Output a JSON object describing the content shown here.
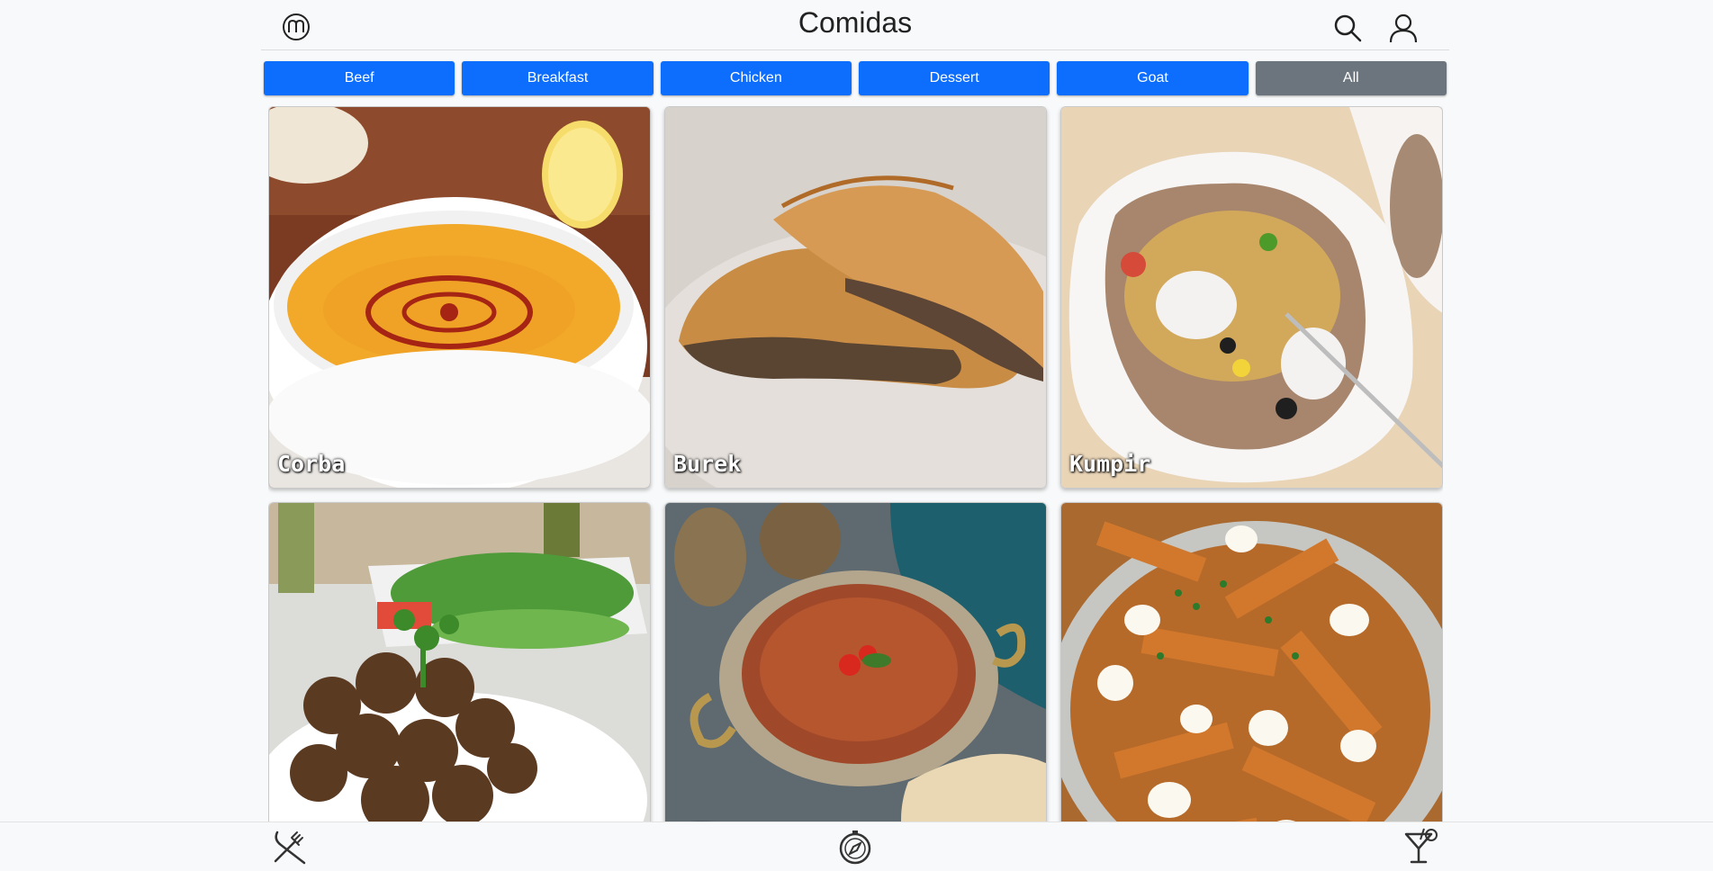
{
  "header": {
    "title": "Comidas",
    "logo_icon": "chef-hat-logo-icon",
    "search_icon": "search-icon",
    "profile_icon": "profile-icon"
  },
  "filters": [
    {
      "label": "Beef",
      "style": "primary"
    },
    {
      "label": "Breakfast",
      "style": "primary"
    },
    {
      "label": "Chicken",
      "style": "primary"
    },
    {
      "label": "Dessert",
      "style": "primary"
    },
    {
      "label": "Goat",
      "style": "primary"
    },
    {
      "label": "All",
      "style": "secondary"
    }
  ],
  "recipes": [
    {
      "name": "Corba"
    },
    {
      "name": "Burek"
    },
    {
      "name": "Kumpir"
    },
    {
      "name": ""
    },
    {
      "name": ""
    },
    {
      "name": ""
    }
  ],
  "footer": {
    "meals_icon": "fork-knife-icon",
    "explore_icon": "compass-icon",
    "drinks_icon": "cocktail-icon"
  },
  "colors": {
    "primary": "#0d6efd",
    "secondary": "#6c757d",
    "background": "#f8f9fa"
  }
}
